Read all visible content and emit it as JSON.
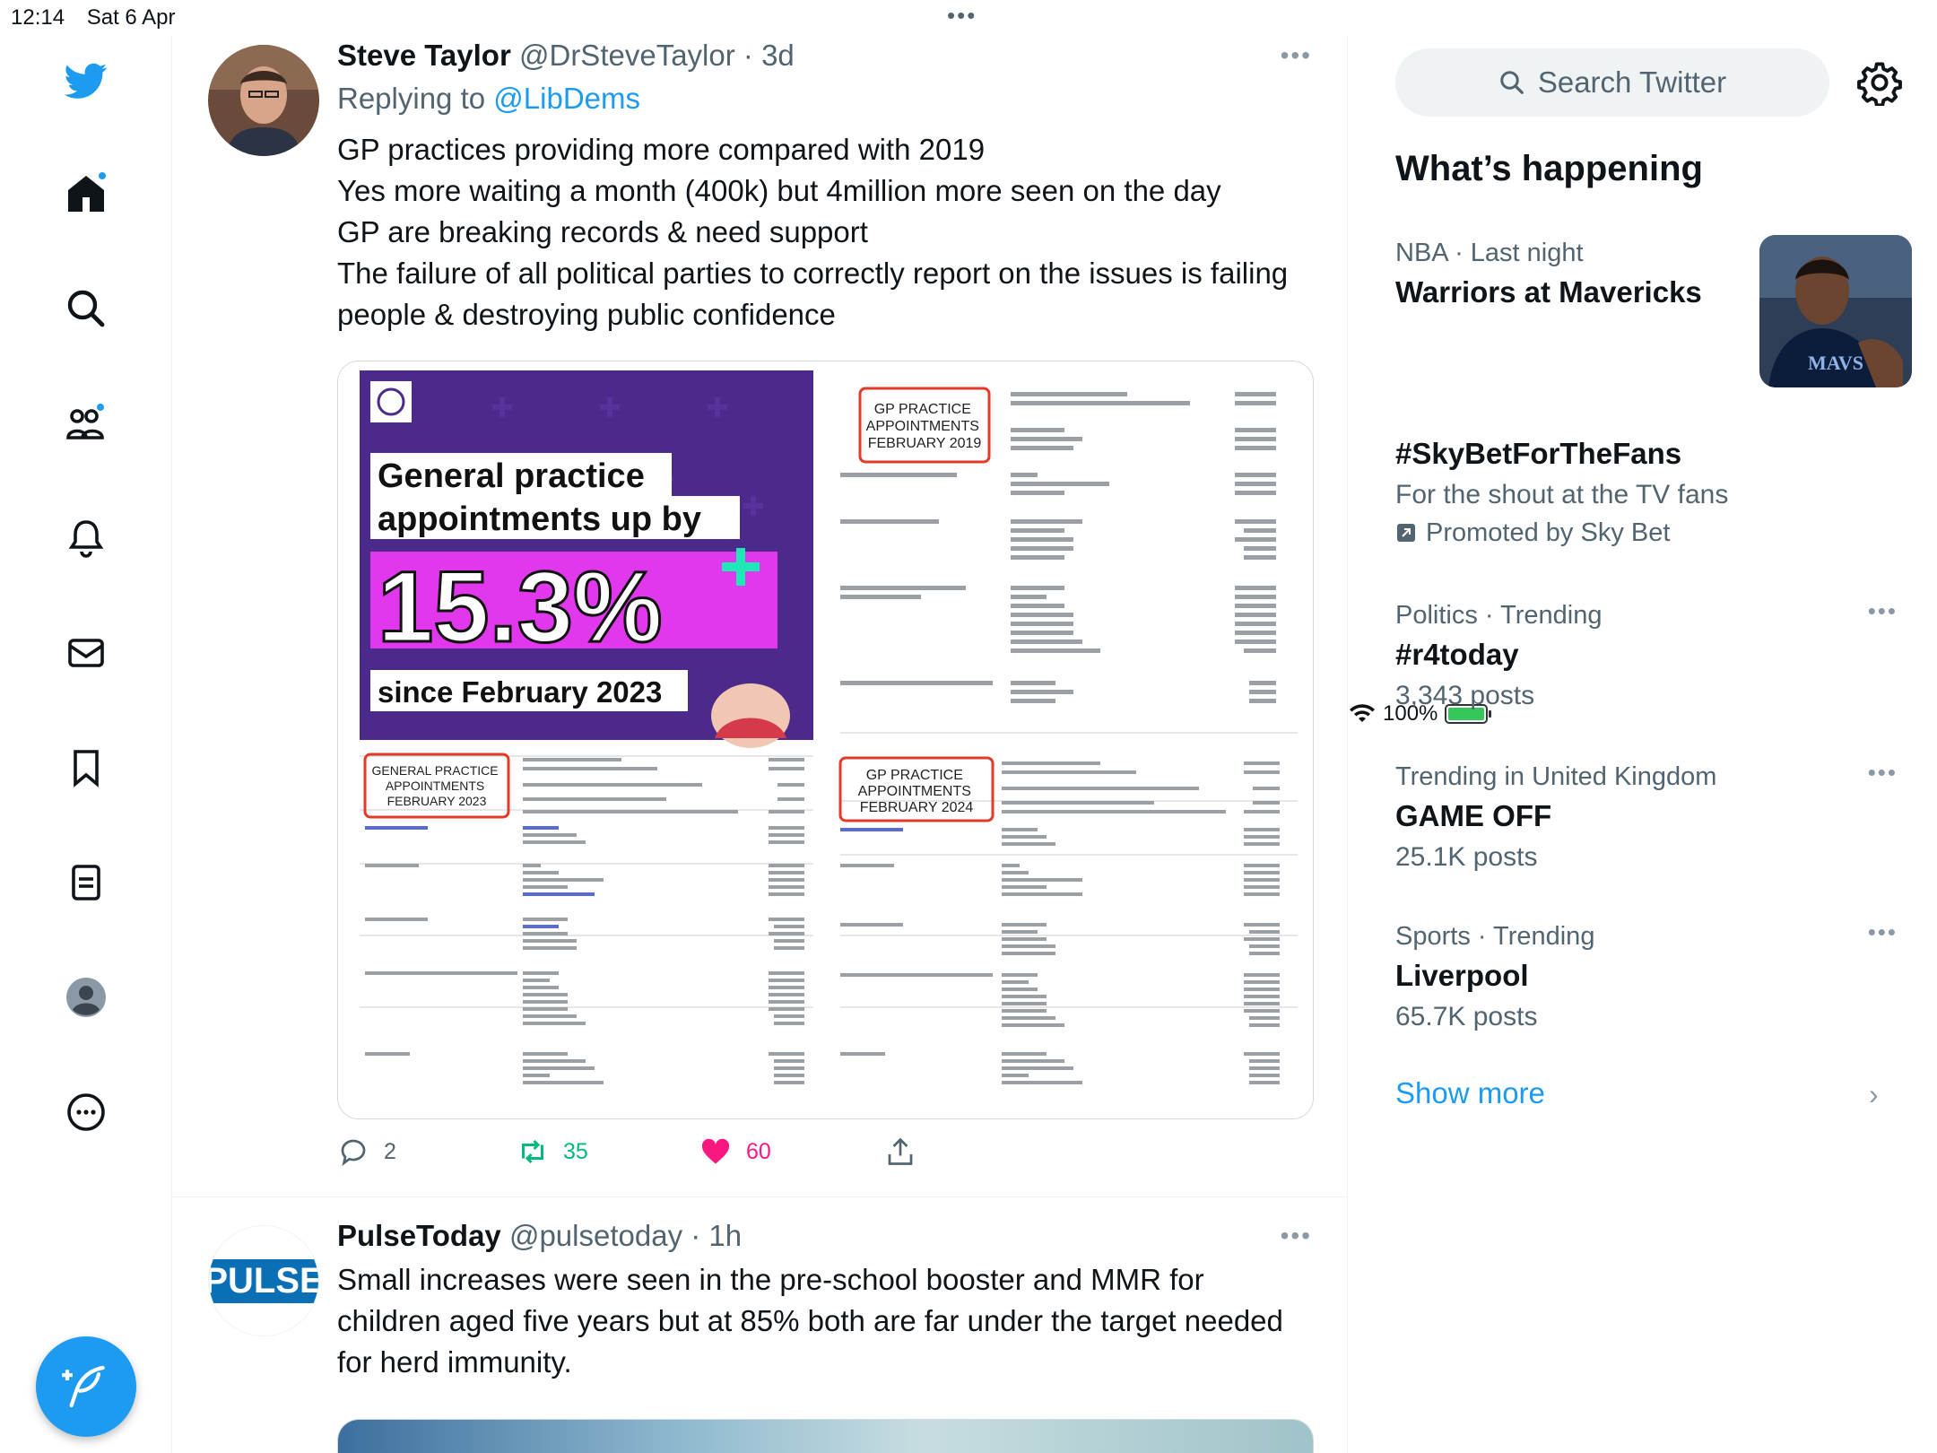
{
  "status_bar": {
    "time": "12:14",
    "date": "Sat 6 Apr",
    "battery": "100%",
    "dots": "•••"
  },
  "sidebar": {
    "items": [
      {
        "icon": "twitter-logo-icon"
      },
      {
        "icon": "home-icon",
        "badge": true
      },
      {
        "icon": "search-icon"
      },
      {
        "icon": "communities-icon",
        "badge": true
      },
      {
        "icon": "bell-icon"
      },
      {
        "icon": "mail-icon"
      },
      {
        "icon": "bookmark-icon"
      },
      {
        "icon": "list-icon"
      },
      {
        "icon": "profile-icon"
      },
      {
        "icon": "more-circle-icon"
      }
    ],
    "compose_icon": "compose-feather-icon"
  },
  "tweets": [
    {
      "name": "Steve Taylor",
      "handle": "@DrSteveTaylor",
      "sep": "·",
      "time": "3d",
      "replying_prefix": "Replying to",
      "replying_to": "@LibDems",
      "text": "GP practices providing more compared with 2019\nYes more waiting a month (400k) but 4million more seen on the day\nGP are breaking records & need support\nThe failure of all political parties to correctly report on the issues is failing people & destroying public confidence",
      "media": {
        "headline1": "General practice",
        "headline2": "appointments up by",
        "big_number": "15.3%",
        "since": "since February 2023",
        "box_2019": "GP PRACTICE\nAPPOINTMENTS\nFEBRUARY 2019",
        "box_2023": "GENERAL PRACTICE\nAPPOINTMENTS\nFEBRUARY 2023",
        "box_2024": "GP PRACTICE\nAPPOINTMENTS\nFEBRUARY 2024"
      },
      "replies": "2",
      "retweets": "35",
      "likes": "60"
    },
    {
      "name": "PulseToday",
      "handle": "@pulsetoday",
      "sep": "·",
      "time": "1h",
      "avatar_text": "PULSE",
      "text": "Small increases were seen in the pre-school booster and MMR for children aged five years but at 85% both are far under the target needed for herd immunity."
    }
  ],
  "right": {
    "search_placeholder": "Search Twitter",
    "heading": "What’s happening",
    "trends": [
      {
        "category": "NBA · Last night",
        "title": "Warriors at Mavericks",
        "has_image": true,
        "jersey": "MAVS"
      },
      {
        "category": "",
        "title": "#SkyBetForTheFans",
        "desc": "For the shout at the TV fans",
        "promoted": "Promoted by Sky Bet"
      },
      {
        "category": "Politics · Trending",
        "title": "#r4today",
        "posts": "3,343 posts"
      },
      {
        "category": "Trending in United Kingdom",
        "title": "GAME OFF",
        "posts": "25.1K posts"
      },
      {
        "category": "Sports · Trending",
        "title": "Liverpool",
        "posts": "65.7K posts"
      }
    ],
    "show_more": "Show more"
  }
}
